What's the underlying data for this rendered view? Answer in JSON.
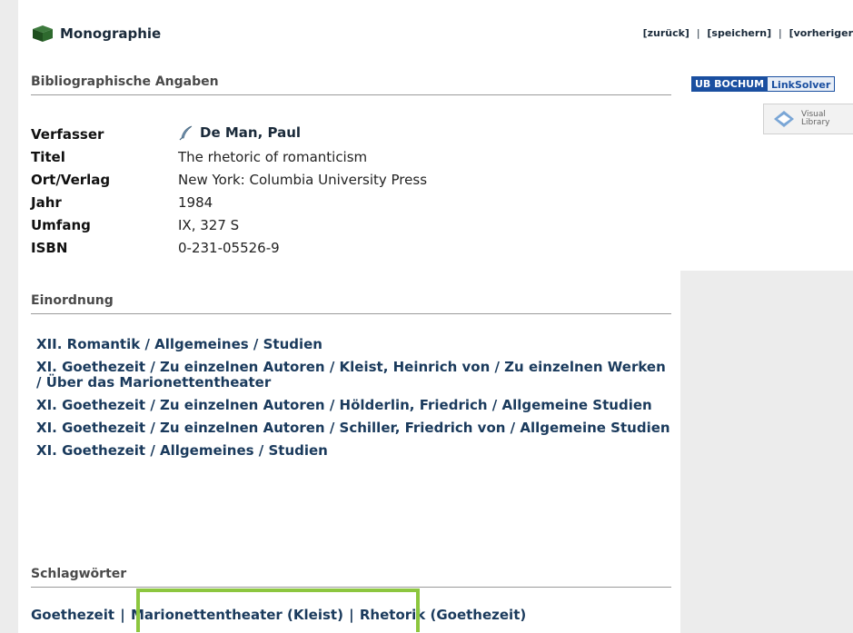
{
  "header": {
    "title": "Monographie",
    "nav": [
      "[zurück]",
      "[speichern]",
      "[vorheriger"
    ],
    "separator": "|"
  },
  "biblio": {
    "header": "Bibliographische Angaben",
    "rows": [
      {
        "label": "Verfasser",
        "value": "De Man, Paul"
      },
      {
        "label": "Titel",
        "value": "The rhetoric of romanticism"
      },
      {
        "label": "Ort/Verlag",
        "value": "New York: Columbia University Press"
      },
      {
        "label": "Jahr",
        "value": "1984"
      },
      {
        "label": "Umfang",
        "value": "IX, 327 S"
      },
      {
        "label": "ISBN",
        "value": "0-231-05526-9"
      }
    ]
  },
  "linksolver": {
    "left": "UB BOCHUM",
    "right": "LinkSolver"
  },
  "visual_library": {
    "line1": "Visual",
    "line2": "Library"
  },
  "einordnung": {
    "header": "Einordnung",
    "items": [
      "XII. Romantik / Allgemeines / Studien",
      "XI. Goethezeit / Zu einzelnen Autoren / Kleist, Heinrich von / Zu einzelnen Werken / Über das Marionettentheater",
      "XI. Goethezeit / Zu einzelnen Autoren / Hölderlin, Friedrich / Allgemeine Studien",
      "XI. Goethezeit / Zu einzelnen Autoren / Schiller, Friedrich von / Allgemeine Studien",
      "XI. Goethezeit / Allgemeines / Studien"
    ]
  },
  "schlagwoerter": {
    "header": "Schlagwörter",
    "items": [
      "Goethezeit",
      "Marionettentheater (Kleist)",
      "Rhetorik (Goethezeit)"
    ],
    "separator": "|"
  },
  "colors": {
    "highlight": "#8cc63f",
    "linksolver_blue": "#1a4fa0"
  }
}
